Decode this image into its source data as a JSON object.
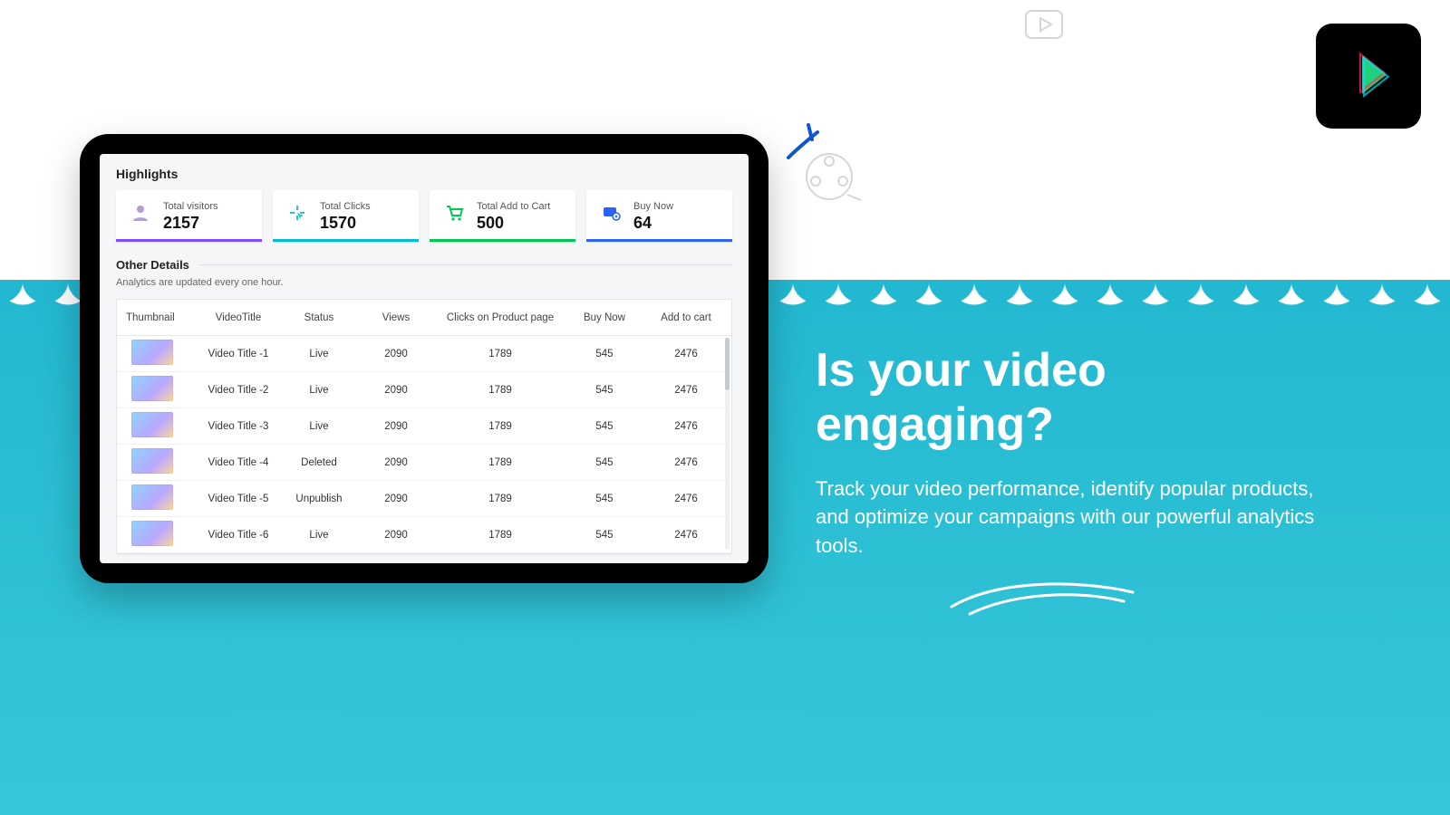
{
  "hero": {
    "title": "Is your video engaging?",
    "body": "Track your video performance, identify popular products, and optimize your campaigns with our powerful analytics tools."
  },
  "dashboard": {
    "highlights_title": "Highlights",
    "cards": [
      {
        "icon": "user-icon",
        "label": "Total visitors",
        "value": "2157",
        "bar": "#7c4dff"
      },
      {
        "icon": "click-icon",
        "label": "Total Clicks",
        "value": "1570",
        "bar": "#00bcd4"
      },
      {
        "icon": "cart-icon",
        "label": "Total Add to Cart",
        "value": "500",
        "bar": "#00c853"
      },
      {
        "icon": "buy-icon",
        "label": "Buy Now",
        "value": "64",
        "bar": "#2962ff"
      }
    ],
    "other_title": "Other Details",
    "note": "Analytics are updated every one hour.",
    "columns": [
      "Thumbnail",
      "VideoTitle",
      "Status",
      "Views",
      "Clicks on Product page",
      "Buy Now",
      "Add to cart"
    ],
    "rows": [
      {
        "title": "Video Title -1",
        "status": "Live",
        "views": "2090",
        "clicks": "1789",
        "buy": "545",
        "add": "2476"
      },
      {
        "title": "Video Title -2",
        "status": "Live",
        "views": "2090",
        "clicks": "1789",
        "buy": "545",
        "add": "2476"
      },
      {
        "title": "Video Title -3",
        "status": "Live",
        "views": "2090",
        "clicks": "1789",
        "buy": "545",
        "add": "2476"
      },
      {
        "title": "Video Title -4",
        "status": "Deleted",
        "views": "2090",
        "clicks": "1789",
        "buy": "545",
        "add": "2476"
      },
      {
        "title": "Video Title -5",
        "status": "Unpublish",
        "views": "2090",
        "clicks": "1789",
        "buy": "545",
        "add": "2476"
      },
      {
        "title": "Video Title -6",
        "status": "Live",
        "views": "2090",
        "clicks": "1789",
        "buy": "545",
        "add": "2476"
      }
    ]
  }
}
